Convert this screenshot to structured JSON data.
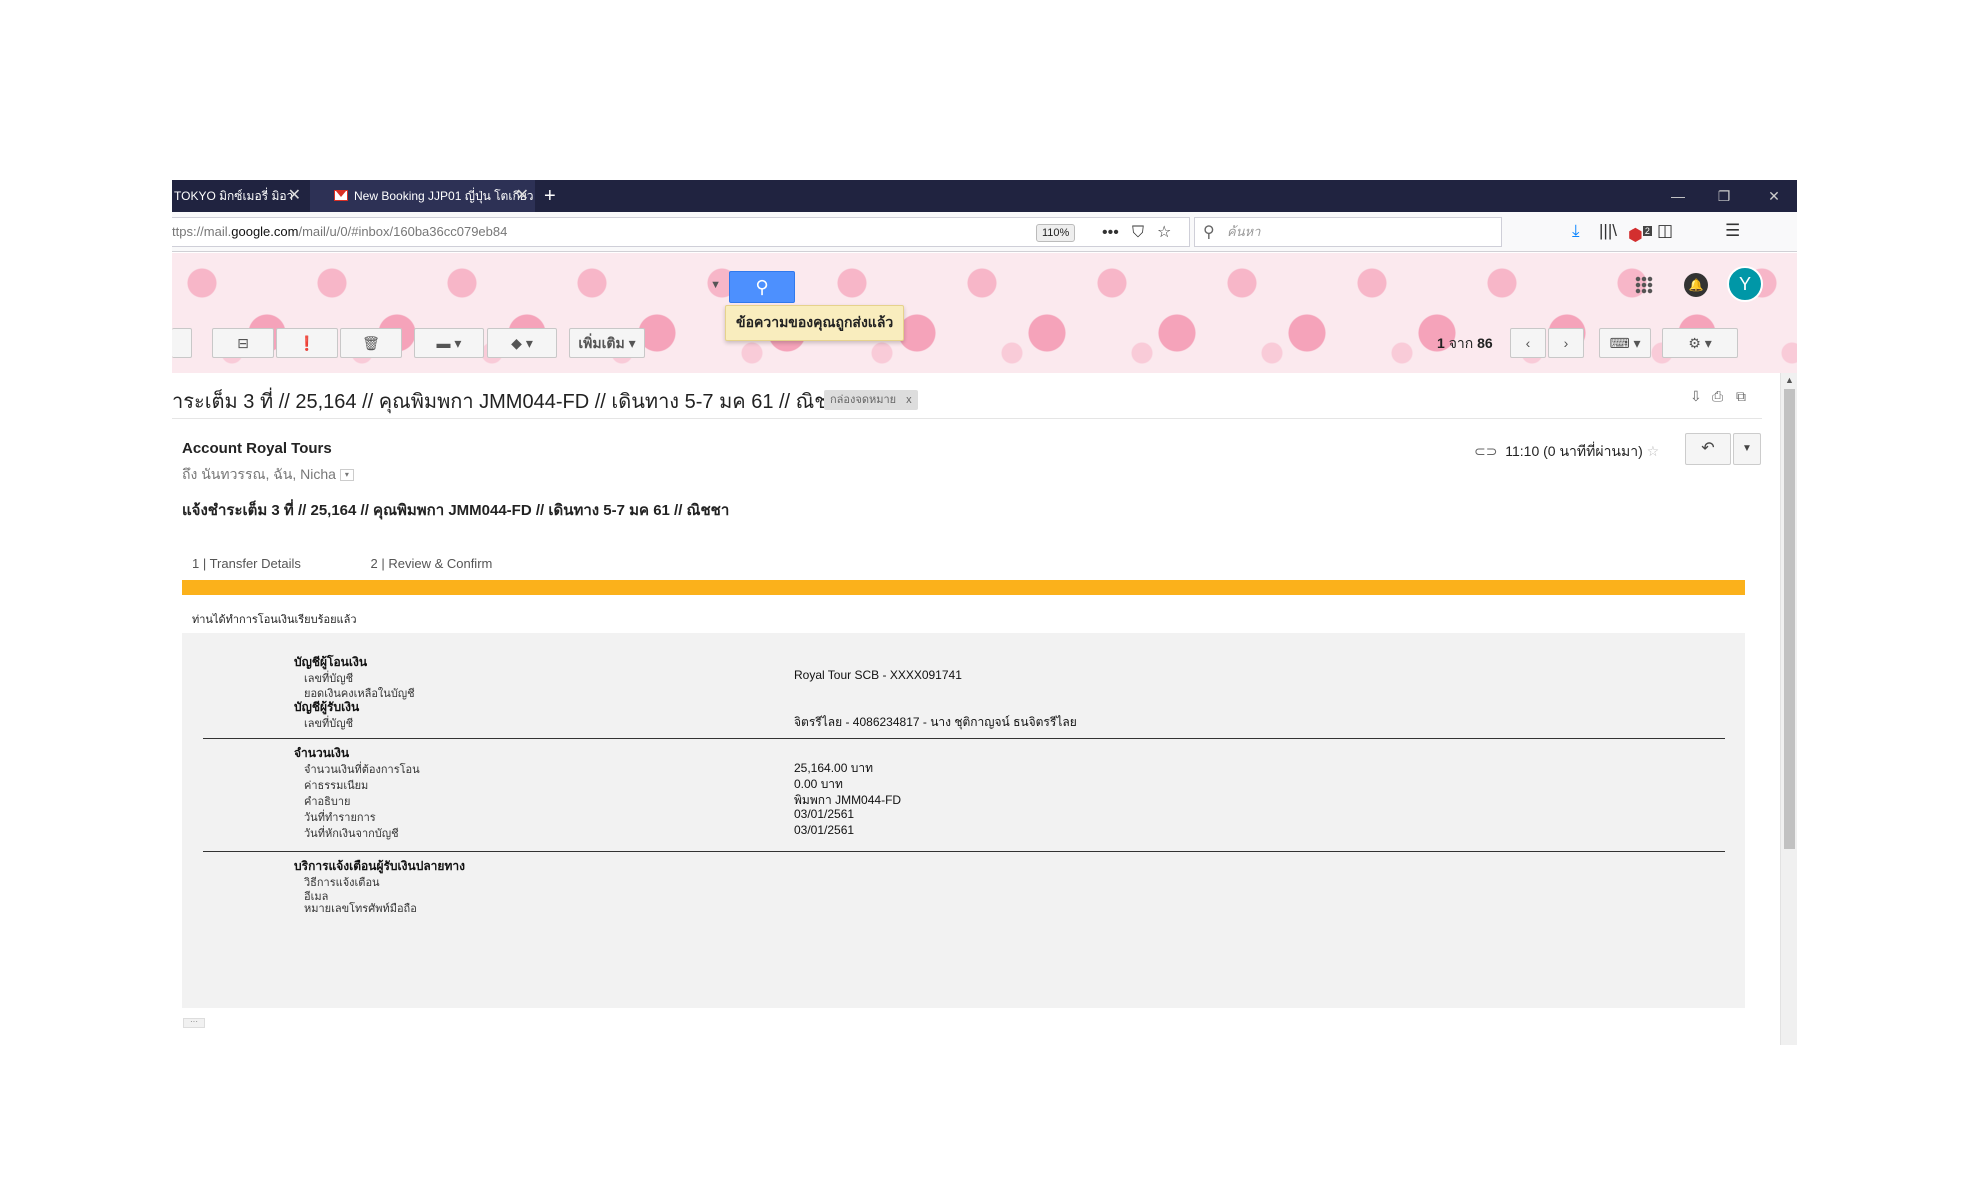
{
  "browser": {
    "tabs": [
      {
        "label": "TOKYO มิกซ์เมอรี่ มิอา"
      },
      {
        "label": "New Booking JJP01 ญี่ปุ่น โตเกียว"
      }
    ],
    "url_prefix": "ttps://mail.",
    "url_domain": "google.com",
    "url_path": "/mail/u/0/#inbox/160ba36cc079eb84",
    "zoom": "110%",
    "search_placeholder": "ค้นหา",
    "addon_badge": "2"
  },
  "gmail": {
    "sent_tooltip": "ข้อความของคุณถูกส่งแล้ว",
    "avatar_letter": "Y",
    "more_label": "เพิ่มเติม",
    "pager_current": "1",
    "pager_of": "จาก",
    "pager_total": "86"
  },
  "message": {
    "subject": "ำระเต็ม 3 ที่ // 25,164 // คุณพิมพกา JMM044-FD // เดินทาง 5-7 มค 61 // ณิชชา",
    "label": "กล่องจดหมาย",
    "label_close": "x",
    "sender": "Account Royal Tours",
    "recipients": "ถึง นันทวรรณ, ฉัน, Nicha",
    "time": "11:10 (0 นาทีที่ผ่านมา)",
    "body_subject": "แจ้งชำระเต็ม 3 ที่ // 25,164 // คุณพิมพกา JMM044-FD // เดินทาง 5-7 มค 61 // ณิชชา"
  },
  "transfer": {
    "steps": [
      "1 | Transfer Details",
      "2 | Review & Confirm"
    ],
    "done_message": "ท่านได้ทำการโอนเงินเรียบร้อยแล้ว",
    "from_section": "บัญชีผู้โอนเงิน",
    "from_account_label": "เลขที่บัญชี",
    "from_account_value": "Royal Tour SCB - XXXX091741",
    "balance_label": "ยอดเงินคงเหลือในบัญชี",
    "to_section": "บัญชีผู้รับเงิน",
    "to_account_label": "เลขที่บัญชี",
    "to_account_value": "จิตรรีไลย - 4086234817 - นาง ชุติกาญจน์ ธนจิตรรีไลย",
    "amount_section": "จำนวนเงิน",
    "amount_label": "จำนวนเงินที่ต้องการโอน",
    "amount_value": "25,164.00 บาท",
    "fee_label": "ค่าธรรมเนียม",
    "fee_value": "0.00  บาท",
    "desc_label": "คำอธิบาย",
    "desc_value": "พิมพกา JMM044-FD",
    "txn_date_label": "วันที่ทำรายการ",
    "txn_date_value": "03/01/2561",
    "debit_date_label": "วันที่หักเงินจากบัญชี",
    "debit_date_value": "03/01/2561",
    "notify_section": "บริการแจ้งเตือนผู้รับเงินปลายทาง",
    "notify_method_label": "วิธีการแจ้งเตือน",
    "email_label": "อีเมล",
    "phone_label": "หมายเลขโทรศัพท์มือถือ"
  },
  "colors": {
    "tabbar": "#202340",
    "accent_bar": "#fbb11b",
    "search_button": "#4d90fe",
    "avatar": "#0097a7"
  }
}
